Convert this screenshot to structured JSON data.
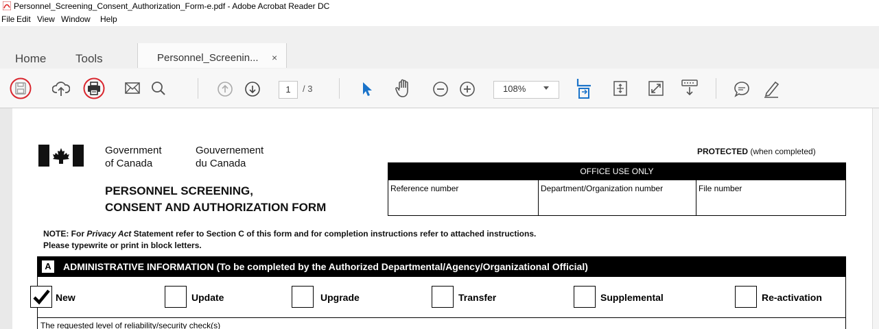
{
  "window": {
    "title": "Personnel_Screening_Consent_Authorization_Form-e.pdf - Adobe Acrobat Reader DC"
  },
  "menu": [
    "File",
    "Edit",
    "View",
    "Window",
    "Help"
  ],
  "nav_tabs": {
    "home": "Home",
    "tools": "Tools",
    "document_tab": "Personnel_Screenin...",
    "close_glyph": "×"
  },
  "toolbar": {
    "current_page": "1",
    "total_pages": "/ 3",
    "zoom": "108%",
    "icons": [
      "save-icon",
      "upload-icon",
      "print-icon",
      "email-icon",
      "search-icon",
      "prev-page-icon",
      "next-page-icon",
      "select-tool-icon",
      "hand-tool-icon",
      "zoom-out-icon",
      "zoom-in-icon",
      "fit-page-icon",
      "scroll-mode-icon",
      "full-screen-icon",
      "read-mode-icon",
      "comment-icon",
      "highlight-icon"
    ],
    "highlighted": [
      "save-icon",
      "print-icon"
    ],
    "highlight_color": "#d9262e"
  },
  "form": {
    "gov_en_1": "Government",
    "gov_en_2": "of Canada",
    "gov_fr_1": "Gouvernement",
    "gov_fr_2": "du Canada",
    "title_1": "PERSONNEL SCREENING,",
    "title_2": "CONSENT AND AUTHORIZATION FORM",
    "protected_bold": "PROTECTED",
    "protected_rest": " (when completed)",
    "office_use": "OFFICE USE ONLY",
    "office_cols": [
      "Reference number",
      "Department/Organization number",
      "File number"
    ],
    "note_prefix": "NOTE: For ",
    "note_italic": "Privacy Act",
    "note_rest": " Statement refer to Section C of this form and for completion instructions refer to attached instructions.",
    "note_line2": "Please typewrite or print in block letters.",
    "section_letter": "A",
    "section_title": "ADMINISTRATIVE INFORMATION  (To be completed by the Authorized Departmental/Agency/Organizational Official)",
    "options": [
      {
        "label": "New",
        "checked": true
      },
      {
        "label": "Update",
        "checked": false
      },
      {
        "label": "Upgrade",
        "checked": false
      },
      {
        "label": "Transfer",
        "checked": false
      },
      {
        "label": "Supplemental",
        "checked": false
      },
      {
        "label": "Re-activation",
        "checked": false
      }
    ],
    "next_row_text": "The requested level of reliability/security check(s)"
  }
}
